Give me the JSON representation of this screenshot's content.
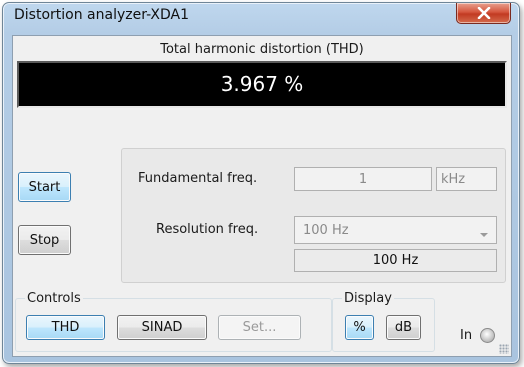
{
  "window": {
    "title": "Distortion analyzer-XDA1"
  },
  "thd": {
    "caption": "Total harmonic distortion (THD)",
    "value": "3.967 %"
  },
  "run": {
    "start_label": "Start",
    "stop_label": "Stop"
  },
  "fundamental": {
    "label": "Fundamental freq.",
    "value": "1",
    "unit": "kHz"
  },
  "resolution": {
    "label": "Resolution freq.",
    "selected": "100 Hz",
    "readout": "100 Hz"
  },
  "controls": {
    "title": "Controls",
    "thd_label": "THD",
    "sinad_label": "SINAD",
    "set_label": "Set..."
  },
  "display": {
    "title": "Display",
    "percent_label": "%",
    "db_label": "dB"
  },
  "input": {
    "label": "In"
  },
  "icons": {
    "close": "close-icon",
    "dropdown": "chevron-down-icon",
    "indicator": "input-indicator-icon",
    "grip": "resize-grip-icon"
  },
  "colors": {
    "display_bg": "#000000",
    "display_text": "#ffffff",
    "active_button": "#bee6fd",
    "close_button": "#c23a22",
    "title_bar": "#b4cde6"
  }
}
